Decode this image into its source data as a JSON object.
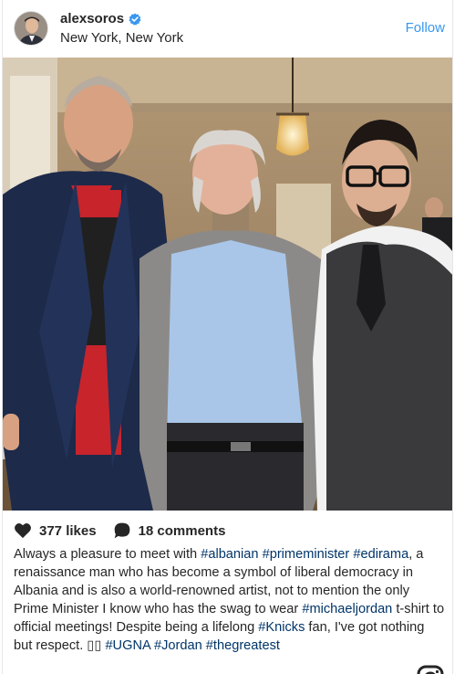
{
  "post": {
    "username": "alexsoros",
    "location": "New York, New York",
    "follow_label": "Follow",
    "likes": "377 likes",
    "comments": "18 comments"
  },
  "caption": {
    "parts": [
      {
        "t": "Always a pleasure to meet with ",
        "tag": false
      },
      {
        "t": "#albanian",
        "tag": true
      },
      {
        "t": " ",
        "tag": false
      },
      {
        "t": "#primeminister",
        "tag": true
      },
      {
        "t": " ",
        "tag": false
      },
      {
        "t": "#edirama",
        "tag": true
      },
      {
        "t": ", a renaissance man who has become a symbol of liberal democracy in Albania and is also a world-renowned artist, not to mention the only Prime Minister I know who has the swag to wear ",
        "tag": false
      },
      {
        "t": "#michaeljordan",
        "tag": true
      },
      {
        "t": " t-shirt to official meetings! Despite being a lifelong ",
        "tag": false
      },
      {
        "t": "#Knicks",
        "tag": true
      },
      {
        "t": " fan, I've got nothing but respect. ▯▯ ",
        "tag": false
      },
      {
        "t": "#UGNA",
        "tag": true
      },
      {
        "t": " ",
        "tag": false
      },
      {
        "t": "#Jordan",
        "tag": true
      },
      {
        "t": " ",
        "tag": false
      },
      {
        "t": "#thegreatest",
        "tag": true
      }
    ]
  },
  "colors": {
    "link_blue": "#3897f0",
    "hashtag": "#003569",
    "text": "#262626"
  },
  "icons": {
    "verified": "verified-badge-icon",
    "like": "heart-icon",
    "comment": "comment-bubble-icon"
  }
}
